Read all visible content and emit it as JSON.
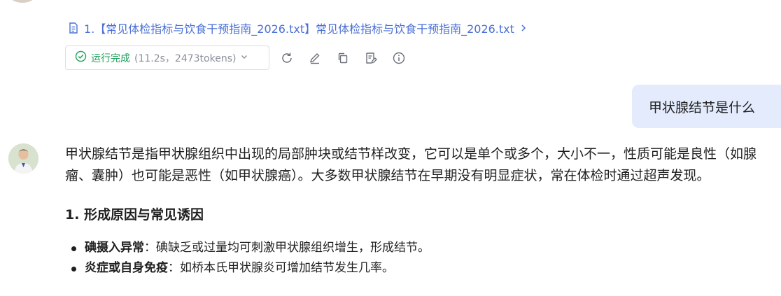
{
  "reference": {
    "text": "1.【常见体检指标与饮食干预指南_2026.txt】常见体检指标与饮食干预指南_2026.txt",
    "icon": "document-icon",
    "arrow_icon": "chevron-right-icon"
  },
  "status": {
    "done_label": "运行完成",
    "meta": "(11.2s，2473tokens)",
    "colors": {
      "done": "#1fa15b",
      "meta": "#8a8f99"
    }
  },
  "actions": [
    "refresh-icon",
    "edit-icon",
    "copy-icon",
    "note-icon",
    "info-icon"
  ],
  "user_message": "甲状腺结节是什么",
  "answer": {
    "intro": "甲状腺结节是指甲状腺组织中出现的局部肿块或结节样改变，它可以是单个或多个，大小不一，性质可能是良性（如腺瘤、囊肿）也可能是恶性（如甲状腺癌）。大多数甲状腺结节在早期没有明显症状，常在体检时通过超声发现。",
    "section_title": "1. 形成原因与常见诱因",
    "items": [
      {
        "term": "碘摄入异常",
        "text": "：碘缺乏或过量均可刺激甲状腺组织增生，形成结节。"
      },
      {
        "term": "炎症或自身免疫",
        "text": "：如桥本氏甲状腺炎可增加结节发生几率。"
      }
    ]
  },
  "colors": {
    "link": "#4a6fd6",
    "user_bubble": "#e3ebfc",
    "text": "#1f1f1f"
  }
}
